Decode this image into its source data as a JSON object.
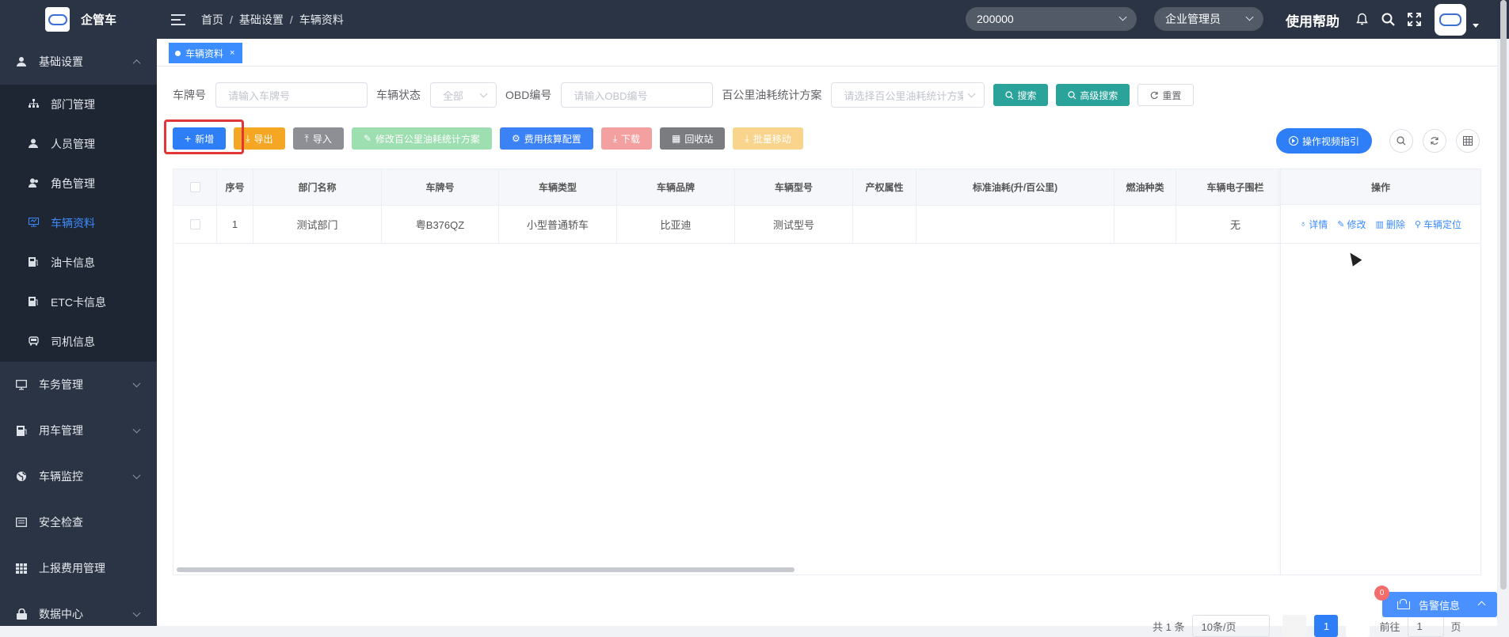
{
  "app": {
    "name": "企管车"
  },
  "sidebar": {
    "groups": [
      {
        "label": "基础设置",
        "icon": "person-icon",
        "expanded": true
      },
      {
        "label": "车务管理",
        "icon": "monitor-icon"
      },
      {
        "label": "用车管理",
        "icon": "card-icon"
      },
      {
        "label": "车辆监控",
        "icon": "globe-icon"
      },
      {
        "label": "安全检查",
        "icon": "form-icon"
      },
      {
        "label": "上报费用管理",
        "icon": "grid-icon"
      },
      {
        "label": "数据中心",
        "icon": "lock-icon"
      }
    ],
    "sub_items": [
      {
        "label": "部门管理",
        "icon": "org-icon"
      },
      {
        "label": "人员管理",
        "icon": "user-icon"
      },
      {
        "label": "角色管理",
        "icon": "users-icon"
      },
      {
        "label": "车辆资料",
        "icon": "vehicle-doc-icon",
        "active": true
      },
      {
        "label": "油卡信息",
        "icon": "fuel-card-icon"
      },
      {
        "label": "ETC卡信息",
        "icon": "etc-card-icon"
      },
      {
        "label": "司机信息",
        "icon": "driver-icon"
      }
    ]
  },
  "header": {
    "breadcrumb": [
      "首页",
      "基础设置",
      "车辆资料"
    ],
    "breadcrumb_sep": "/",
    "company_select": "200000",
    "role_select": "企业管理员",
    "help": "使用帮助"
  },
  "tabs": [
    {
      "label": "车辆资料",
      "close": "×"
    }
  ],
  "search": {
    "plate_label": "车牌号",
    "plate_placeholder": "请输入车牌号",
    "status_label": "车辆状态",
    "status_value": "全部",
    "obd_label": "OBD编号",
    "obd_placeholder": "请输入OBD编号",
    "scheme_label": "百公里油耗统计方案",
    "scheme_placeholder": "请选择百公里油耗统计方案",
    "search_btn": "搜索",
    "advanced_btn": "高级搜索",
    "reset_btn": "重置"
  },
  "toolbar": {
    "add": "新增",
    "export": "导出",
    "import": "导入",
    "modify_scheme": "修改百公里油耗统计方案",
    "cost_config": "费用核算配置",
    "download": "下载",
    "recycle": "回收站",
    "batch_move": "批量移动",
    "video_guide": "操作视频指引"
  },
  "table": {
    "columns": [
      "序号",
      "部门名称",
      "车牌号",
      "车辆类型",
      "车辆品牌",
      "车辆型号",
      "产权属性",
      "标准油耗(升/百公里)",
      "燃油种类",
      "车辆电子围栏"
    ],
    "ops_header": "操作",
    "rows": [
      [
        "1",
        "测试部门",
        "粤B376QZ",
        "小型普通轿车",
        "比亚迪",
        "测试型号",
        "",
        "",
        "",
        "无"
      ]
    ],
    "ops": [
      "详情",
      "修改",
      "删除",
      "车辆定位"
    ]
  },
  "pagination": {
    "total": "共 1 条",
    "size": "10条/页",
    "page": "1",
    "goto": "前往",
    "goto_page": "1",
    "page_unit": "页"
  },
  "alert": {
    "label": "告警信息",
    "count": "0"
  },
  "colors": {
    "sidebar_bg": "#2b3444",
    "accent": "#3b8cff",
    "teal": "#2aa39a",
    "highlight": "#e23535"
  }
}
